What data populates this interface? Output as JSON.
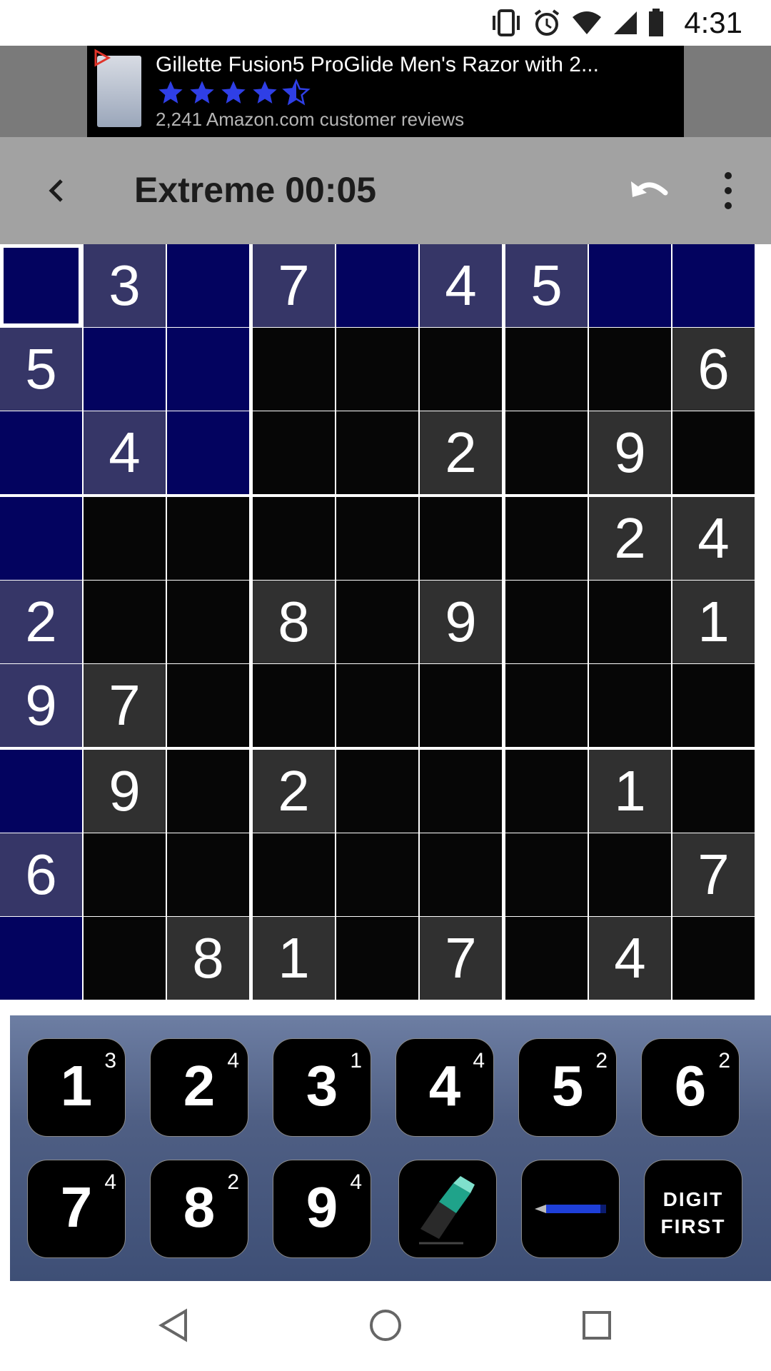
{
  "status_bar": {
    "time": "4:31"
  },
  "ad": {
    "title": "Gillette Fusion5 ProGlide Men's Razor with 2...",
    "rating": 4.5,
    "reviews": "2,241 Amazon.com customer reviews",
    "star_color": "#2f3fe6"
  },
  "toolbar": {
    "title": "Extreme  00:05"
  },
  "board": {
    "highlight_color": "#03035f",
    "given_color": "#303030",
    "selected_cell": [
      0,
      0
    ],
    "rows": [
      [
        "",
        "3",
        "",
        "7",
        "",
        "4",
        "5",
        "",
        ""
      ],
      [
        "5",
        "",
        "",
        "",
        "",
        "",
        "",
        "",
        "6"
      ],
      [
        "",
        "4",
        "",
        "",
        "",
        "2",
        "",
        "9",
        ""
      ],
      [
        "",
        "",
        "",
        "",
        "",
        "",
        "",
        "2",
        "4"
      ],
      [
        "2",
        "",
        "",
        "8",
        "",
        "9",
        "",
        "",
        "1"
      ],
      [
        "9",
        "7",
        "",
        "",
        "",
        "",
        "",
        "",
        ""
      ],
      [
        "",
        "9",
        "",
        "2",
        "",
        "",
        "",
        "1",
        ""
      ],
      [
        "6",
        "",
        "",
        "",
        "",
        "",
        "",
        "",
        "7"
      ],
      [
        "",
        "",
        "8",
        "1",
        "",
        "7",
        "",
        "4",
        ""
      ]
    ]
  },
  "keypad": {
    "digits": [
      {
        "digit": "1",
        "count": "3"
      },
      {
        "digit": "2",
        "count": "4"
      },
      {
        "digit": "3",
        "count": "1"
      },
      {
        "digit": "4",
        "count": "4"
      },
      {
        "digit": "5",
        "count": "2"
      },
      {
        "digit": "6",
        "count": "2"
      },
      {
        "digit": "7",
        "count": "4"
      },
      {
        "digit": "8",
        "count": "2"
      },
      {
        "digit": "9",
        "count": "4"
      }
    ],
    "eraser_icon": "eraser-icon",
    "pencil_icon": "pencil-icon",
    "mode_line1": "DIGIT",
    "mode_line2": "FIRST"
  }
}
